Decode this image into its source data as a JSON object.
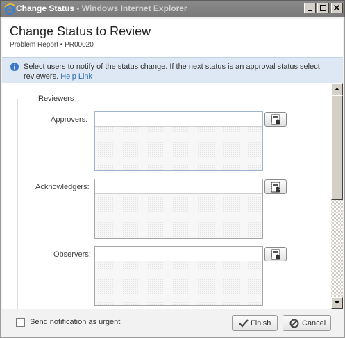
{
  "window": {
    "title_prefix": "Change Status",
    "title_suffix": " - Windows Internet Explorer"
  },
  "header": {
    "title": "Change Status to Review",
    "subtitle": "Problem Report • PR00020"
  },
  "info": {
    "message": "Select users to notify of the status change. If the next status is an approval status select reviewers.",
    "link": "Help Link"
  },
  "reviewers": {
    "legend": "Reviewers",
    "approvers_label": "Approvers:",
    "acknowledgers_label": "Acknowledgers:",
    "observers_label": "Observers:"
  },
  "footer": {
    "urgent_label": "Send notification as urgent",
    "urgent_checked": false,
    "finish_label": "Finish",
    "cancel_label": "Cancel"
  },
  "icons": {
    "title_icon": "internet-explorer-icon",
    "info_icon": "info-icon",
    "picker_icon": "address-book-icon",
    "finish_icon": "checkmark-icon",
    "cancel_icon": "cancel-circle-icon"
  }
}
